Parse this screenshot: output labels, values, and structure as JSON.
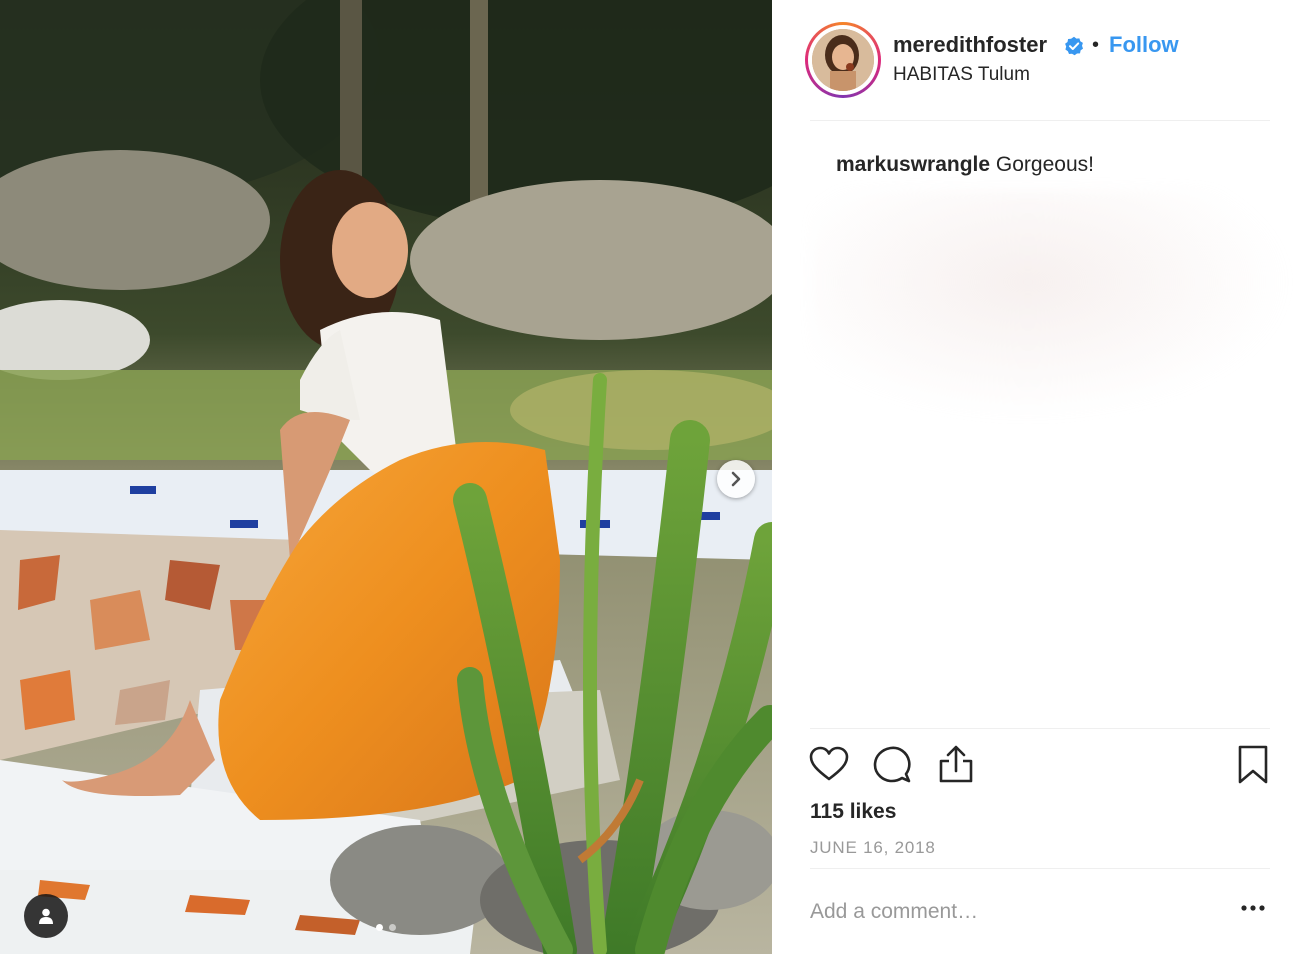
{
  "post": {
    "username": "meredithfoster",
    "follow_label": "Follow",
    "bullet": "•",
    "location": "HABITAS Tulum",
    "comments": [
      {
        "user": "markuswrangle",
        "text": "Gorgeous!"
      }
    ],
    "likes": "115 likes",
    "date": "JUNE 16, 2018",
    "comment_placeholder": "Add a comment…"
  },
  "carousel": {
    "total_slides": 2,
    "active_slide": 1
  },
  "icons": {
    "verified": "verified-badge-icon",
    "like": "heart-icon",
    "comment": "comment-bubble-icon",
    "share": "share-icon",
    "save": "bookmark-icon",
    "next": "chevron-right-icon",
    "tag": "user-tag-icon",
    "more": "more-options-icon"
  },
  "colors": {
    "accent": "#3897f0",
    "text": "#262626",
    "muted": "#999999",
    "divider": "#efefef"
  }
}
